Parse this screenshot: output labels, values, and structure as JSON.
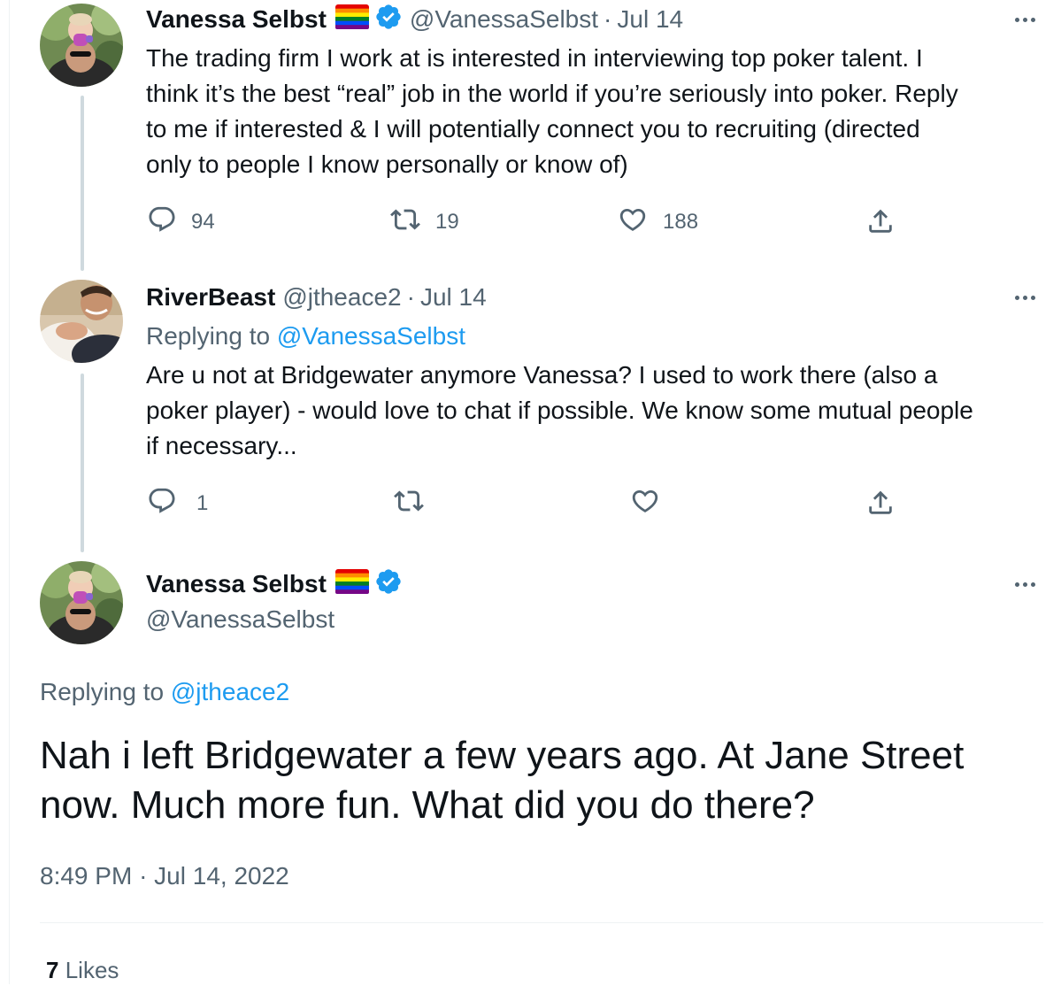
{
  "tweets": [
    {
      "name": "Vanessa Selbst",
      "handle": "@VanessaSelbst",
      "dot": "·",
      "date": "Jul 14",
      "text_lines": [
        "The trading firm I work at is interested in interviewing top poker talent. I",
        "think it’s the best “real” job in the world if you’re seriously into poker. Reply",
        "to me if interested & I will potentially connect you to recruiting (directed",
        "only to people I know personally or know of)"
      ],
      "replies": "94",
      "retweets": "19",
      "likes": "188"
    },
    {
      "name": "RiverBeast",
      "handle": "@jtheace2",
      "dot": "·",
      "date": "Jul 14",
      "replying_prefix": "Replying to ",
      "replying_handle": "@VanessaSelbst",
      "text_lines": [
        "Are u not at Bridgewater anymore Vanessa? I used to work there (also a",
        "poker player) - would love to chat if possible.  We know some mutual people",
        "if necessary..."
      ],
      "replies": "1",
      "retweets": "",
      "likes": ""
    }
  ],
  "main_tweet": {
    "name": "Vanessa Selbst",
    "handle": "@VanessaSelbst",
    "replying_prefix": "Replying to ",
    "replying_handle": "@jtheace2",
    "text_lines": [
      "Nah i left Bridgewater a few years ago. At Jane Street",
      "now. Much more fun. What did you do there?"
    ],
    "time": "8:49 PM",
    "dot": "·",
    "date": "Jul 14, 2022",
    "likes_count": "7",
    "likes_label": "Likes"
  },
  "colors": {
    "text_primary": "#0f1419",
    "text_secondary": "#536471",
    "link": "#1d9bf0",
    "verified": "#1d9bf0",
    "thread_line": "#cfd9de",
    "divider": "#eff3f4"
  },
  "icons": {
    "reply": "reply-icon",
    "retweet": "retweet-icon",
    "like": "heart-icon",
    "share": "share-icon",
    "more": "more-icon",
    "verified": "verified-badge-icon",
    "flag": "rainbow-flag-icon"
  }
}
